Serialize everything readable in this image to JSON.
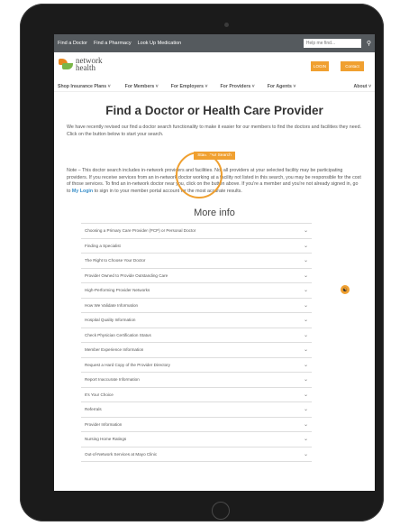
{
  "topbar": {
    "links": [
      "Find a Doctor",
      "Find a Pharmacy",
      "Look Up Medication"
    ],
    "search_placeholder": "Help me find...",
    "search_icon": "search-icon"
  },
  "logo": {
    "line1": "network",
    "line2": "health"
  },
  "header": {
    "login": "LOGIN",
    "contact": "Contact"
  },
  "nav": [
    "Shop Insurance Plans ˅",
    "For Members ˅",
    "For Employers ˅",
    "For Providers ˅",
    "For Agents ˅",
    "About ˅"
  ],
  "main": {
    "title": "Find a Doctor or Health Care Provider",
    "intro": "We have recently revised our find a doctor search functionality to make it easier for our members to find the doctors and facilities they need. Click on the button below to start your search.",
    "cta": "Start Your Search",
    "note_before": "Note – This doctor search includes in-network providers and facilities. Not all providers at your selected facility may be participating providers. If you receive services from an in-network doctor working at a facility not listed in this search, you may be responsible for the cost of those services. To find an in-network doctor near you, click on the button above. If you're a member and you're not already signed in, go to ",
    "my_login": "My Login",
    "note_after": " to sign in to your member portal account for the most accurate results.",
    "more_info_title": "More info",
    "accordion": [
      "Choosing a Primary Care Provider (PCP) or Personal Doctor",
      "Finding a Specialist",
      "The Right to Choose Your Doctor",
      "Provider Owned to Provide Outstanding Care",
      "High-Performing Provider Networks",
      "How We Validate Information",
      "Hospital Quality Information",
      "Check Physician Certification Status",
      "Member Experience Information",
      "Request a Hard Copy of the Provider Directory",
      "Report Inaccurate Information",
      "It's Your Choice",
      "Referrals",
      "Provider Information",
      "Nursing Home Ratings",
      "Out-of-Network Services at Mayo Clinic"
    ]
  },
  "colors": {
    "accent": "#f0a030",
    "link": "#3a8fc9",
    "topbar": "#555a5e"
  }
}
